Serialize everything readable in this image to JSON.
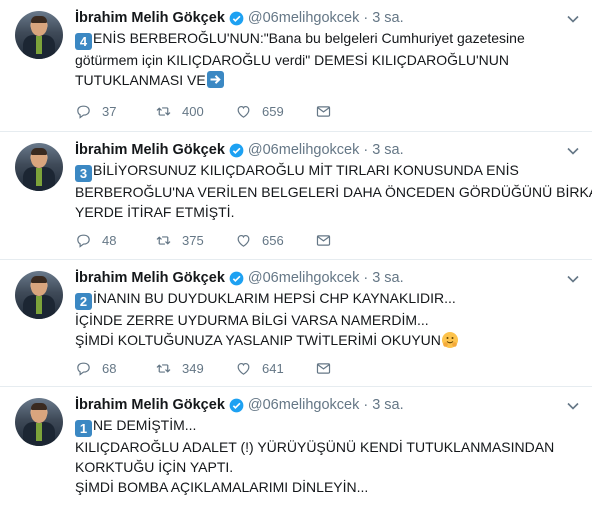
{
  "user": {
    "name": "İbrahim Melih Gökçek",
    "handle": "@06melihgokcek",
    "separator": "·"
  },
  "tweets": [
    {
      "time": "3 sa.",
      "number": "4",
      "lines": [
        "ENİS BERBEROĞLU'NUN:\"Bana bu belgeleri Cumhuriyet gazetesine",
        "götürmem için KILIÇDAROĞLU verdi\" DEMESİ KILIÇDAROĞLU'NUN",
        "TUTUKLANMASI VE"
      ],
      "replies": "37",
      "retweets": "400",
      "likes": "659"
    },
    {
      "time": "3 sa.",
      "number": "3",
      "lines": [
        "BİLİYORSUNUZ KILIÇDAROĞLU MİT TIRLARI KONUSUNDA ENİS",
        "BERBEROĞLU'NA VERİLEN BELGELERİ DAHA ÖNCEDEN GÖRDÜĞÜNÜ BİRKAÇ",
        "YERDE İTİRAF ETMİŞTİ."
      ],
      "replies": "48",
      "retweets": "375",
      "likes": "656"
    },
    {
      "time": "3 sa.",
      "number": "2",
      "lines": [
        "İNANIN BU DUYDUKLARIM HEPSİ CHP KAYNAKLIDIR...",
        "İÇİNDE ZERRE UYDURMA BİLGİ VARSA NAMERDİM...",
        "ŞİMDİ KOLTUĞUNUZA YASLANIP TWİTLERİMİ OKUYUN"
      ],
      "replies": "68",
      "retweets": "349",
      "likes": "641"
    },
    {
      "time": "3 sa.",
      "number": "1",
      "lines": [
        "NE DEMİŞTİM...",
        "KILIÇDAROĞLU ADALET (!) YÜRÜYÜŞÜNÜ KENDİ TUTUKLANMASINDAN",
        "KORKTUĞU İÇİN YAPTI.",
        "ŞİMDİ BOMBA AÇIKLAMALARIMI DİNLEYİN..."
      ]
    }
  ]
}
